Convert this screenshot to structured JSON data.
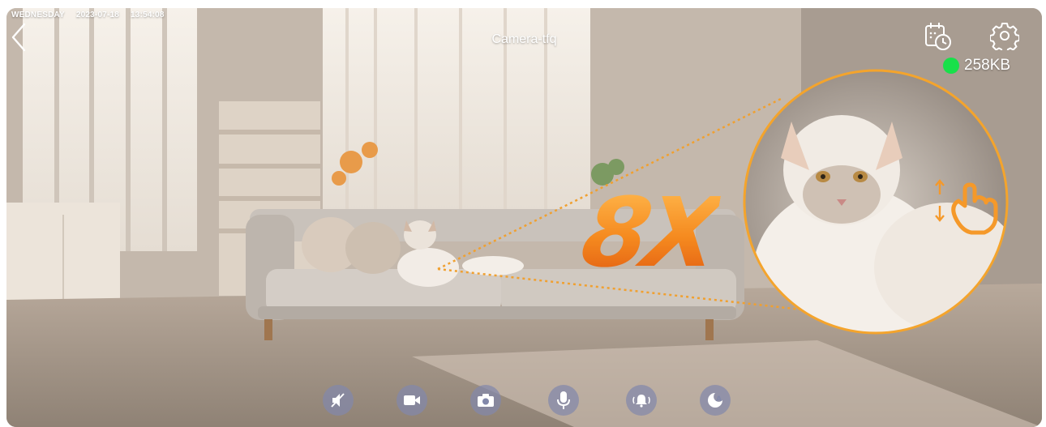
{
  "header": {
    "weekday": "WEDNESDAY",
    "date": "2023-07-18",
    "time": "13:54:08",
    "camera_name": "Camera-tfq"
  },
  "status": {
    "data_rate": "258KB",
    "indicator_color": "#18e04a"
  },
  "zoom": {
    "label": "8X",
    "accent_color": "#f58a1f"
  },
  "icons": {
    "back": "back-chevron-icon",
    "playback": "calendar-clock-icon",
    "settings": "gear-icon"
  },
  "toolbar": {
    "buttons": [
      {
        "name": "mute-button",
        "icon": "speaker-muted-icon"
      },
      {
        "name": "record-button",
        "icon": "video-camera-icon"
      },
      {
        "name": "snapshot-button",
        "icon": "camera-icon"
      },
      {
        "name": "talk-button",
        "icon": "microphone-icon"
      },
      {
        "name": "alarm-button",
        "icon": "bell-ringing-icon"
      },
      {
        "name": "auto-button",
        "icon": "auto-mode-icon"
      }
    ],
    "button_color": "#8288aa"
  }
}
